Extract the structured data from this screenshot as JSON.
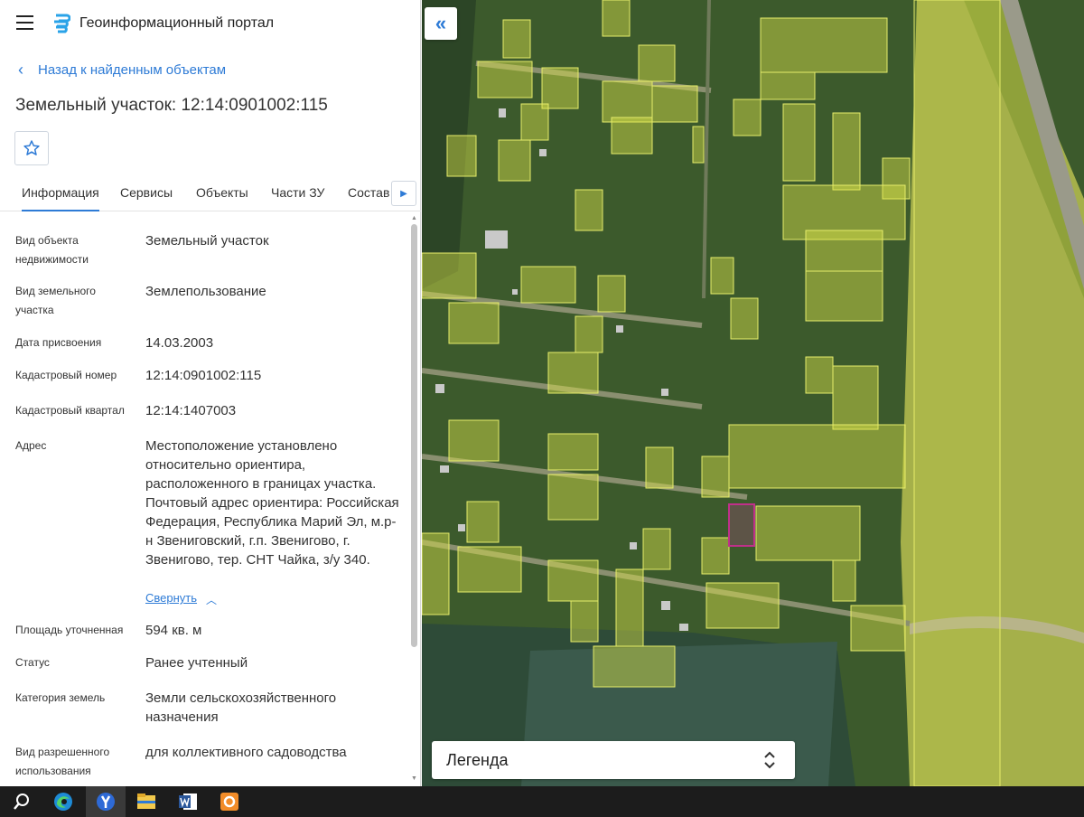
{
  "header": {
    "title": "Геоинформационный портал"
  },
  "nav": {
    "back_label": "Назад к найденным объектам"
  },
  "object": {
    "title": "Земельный участок: 12:14:0901002:115"
  },
  "tabs": [
    {
      "label": "Информация",
      "active": true
    },
    {
      "label": "Сервисы"
    },
    {
      "label": "Объекты"
    },
    {
      "label": "Части ЗУ"
    },
    {
      "label": "Состав"
    }
  ],
  "info": [
    {
      "label": "Вид объекта недвижимости",
      "value": "Земельный участок"
    },
    {
      "label": "Вид земельного участка",
      "value": "Землепользование"
    },
    {
      "label": "Дата присвоения",
      "value": "14.03.2003"
    },
    {
      "label": "Кадастровый номер",
      "value": "12:14:0901002:115"
    },
    {
      "label": "Кадастровый квартал",
      "value": "12:14:1407003"
    },
    {
      "label": "Адрес",
      "value": "Местоположение установлено относительно ориентира, расположенного в границах участка. Почтовый адрес ориентира: Российская Федерация, Республика Марий Эл, м.р-н Звениговский, г.п. Звенигово, г. Звенигово, тер. СНТ Чайка, з/у 340."
    },
    {
      "label": "Площадь уточненная",
      "value": "594 кв. м"
    },
    {
      "label": "Статус",
      "value": "Ранее учтенный"
    },
    {
      "label": "Категория земель",
      "value": "Земли сельскохозяйственного назначения"
    },
    {
      "label": "Вид разрешенного использования",
      "value": "для коллективного садоводства"
    }
  ],
  "address_toggle": {
    "label": "Свернуть"
  },
  "legend": {
    "label": "Легенда"
  },
  "colors": {
    "accent": "#2e7bd6",
    "parcel_fill": "#d9e24a",
    "selected_parcel": "#c0308a"
  },
  "taskbar": [
    {
      "icon": "search-icon"
    },
    {
      "icon": "edge-browser-icon"
    },
    {
      "icon": "yandex-browser-icon",
      "active": true
    },
    {
      "icon": "file-explorer-icon"
    },
    {
      "icon": "word-icon"
    },
    {
      "icon": "orange-app-icon"
    }
  ]
}
